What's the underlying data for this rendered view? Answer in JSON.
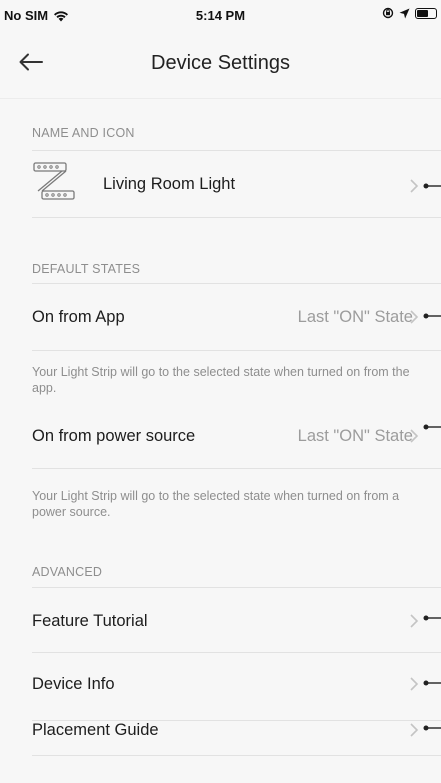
{
  "status_bar": {
    "carrier": "No SIM",
    "time": "5:14 PM"
  },
  "nav": {
    "title": "Device Settings"
  },
  "sections": {
    "name_and_icon": {
      "header": "NAME AND ICON",
      "device_name": "Living Room Light"
    },
    "default_states": {
      "header": "DEFAULT STATES",
      "on_from_app": {
        "label": "On from App",
        "value": "Last \"ON\" State",
        "help": "Your Light Strip will go to the selected state when turned on from the app."
      },
      "on_from_power": {
        "label": "On from power source",
        "value": "Last \"ON\" State",
        "help": "Your Light Strip will go to the selected state when turned on from a power source."
      }
    },
    "advanced": {
      "header": "ADVANCED",
      "items": [
        {
          "label": "Feature Tutorial"
        },
        {
          "label": "Device Info"
        },
        {
          "label": "Placement Guide"
        }
      ]
    }
  },
  "colors": {
    "background": "#f7f7f7",
    "primary_text": "#1d1d1d",
    "secondary_text": "#8e8e8e",
    "value_text": "#9c9c9c",
    "divider": "#e2e2e2"
  }
}
